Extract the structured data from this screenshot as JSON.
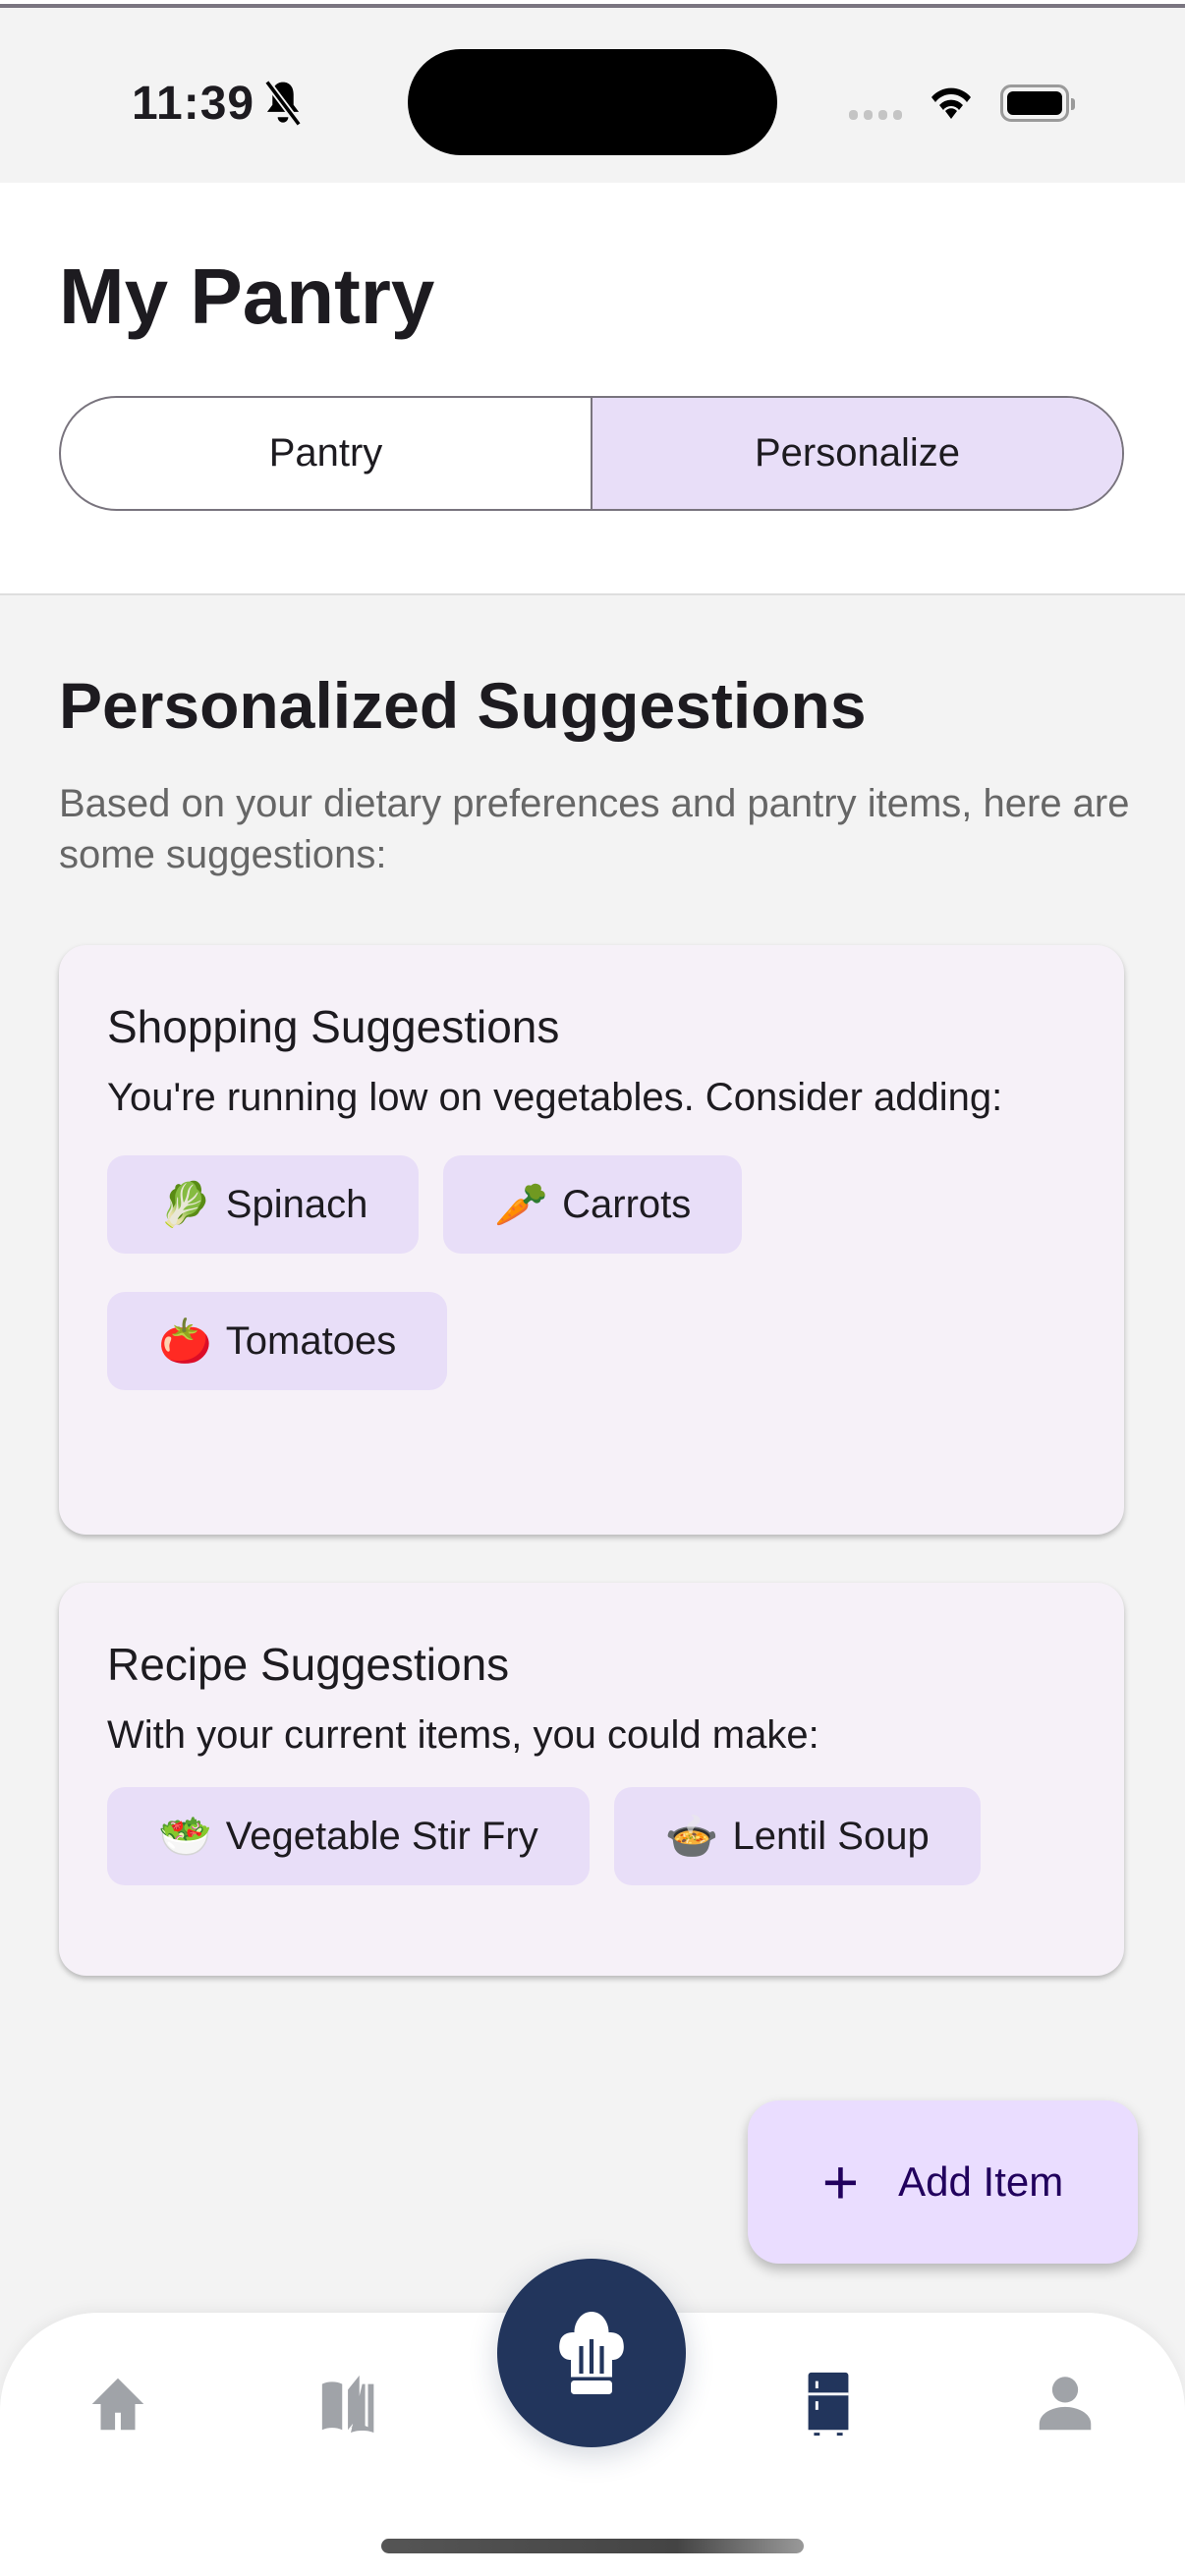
{
  "status_bar": {
    "time": "11:39"
  },
  "header": {
    "title": "My Pantry",
    "tabs": [
      {
        "label": "Pantry",
        "active": false
      },
      {
        "label": "Personalize",
        "active": true
      }
    ]
  },
  "section": {
    "title": "Personalized Suggestions",
    "subtitle": "Based on your dietary preferences and pantry items, here are some suggestions:"
  },
  "shopping": {
    "title": "Shopping Suggestions",
    "text": "You're running low on vegetables. Consider adding:",
    "chips": [
      {
        "emoji": "🥬",
        "label": "Spinach"
      },
      {
        "emoji": "🥕",
        "label": "Carrots"
      },
      {
        "emoji": "🍅",
        "label": "Tomatoes"
      }
    ]
  },
  "recipes": {
    "title": "Recipe Suggestions",
    "text": "With your current items, you could make:",
    "chips": [
      {
        "emoji": "🥗",
        "label": "Vegetable Stir Fry"
      },
      {
        "emoji": "🍲",
        "label": "Lentil Soup"
      }
    ]
  },
  "fab": {
    "label": "Add Item",
    "icon": "plus-icon"
  },
  "nav": {
    "items": [
      "home-icon",
      "book-icon",
      "chef-hat-icon",
      "fridge-icon",
      "person-icon"
    ],
    "active": "fridge-icon"
  },
  "colors": {
    "accent": "#e8def8",
    "fab": "#eaddff",
    "nav_active": "#22355c",
    "nav_inactive": "#a0a3a8"
  }
}
